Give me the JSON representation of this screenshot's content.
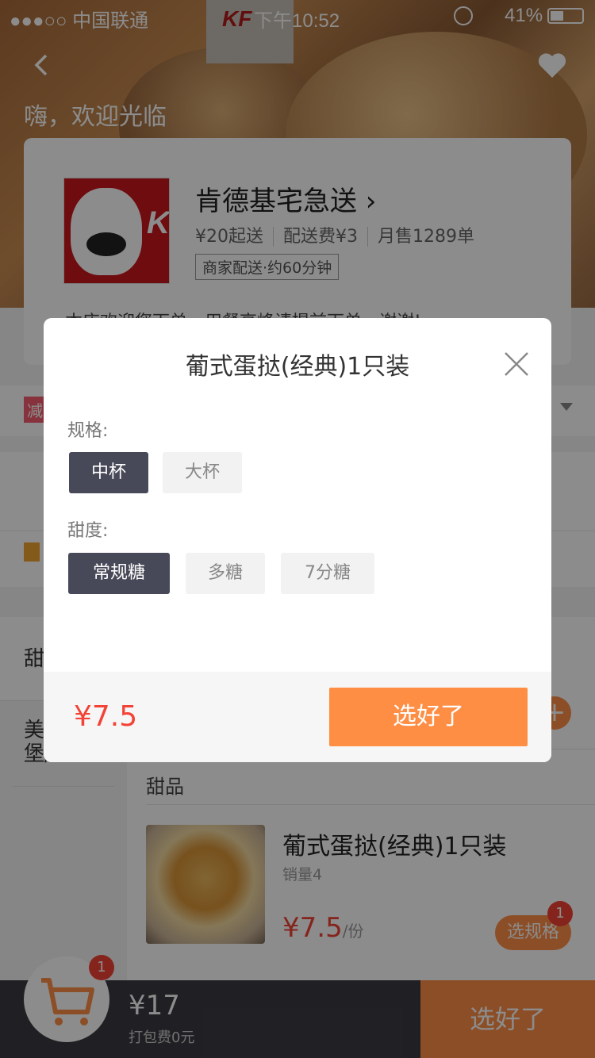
{
  "status_bar": {
    "carrier": "●●●○○ 中国联通",
    "time": "下午10:52",
    "battery": "41%"
  },
  "header": {
    "greeting": "嗨，欢迎光临"
  },
  "shop": {
    "name": "肯德基宅急送",
    "min_order": "¥20起送",
    "delivery_fee": "配送费¥3",
    "monthly_sales": "月售1289单",
    "delivery_tag": "商家配送·约60分钟",
    "notice": "本店欢迎您下单，用餐高峰请提前下单，谢谢!"
  },
  "promo": {
    "badge": "减"
  },
  "side_nav": {
    "items": [
      {
        "label": "甜"
      },
      {
        "label": "美\n堡/包"
      }
    ]
  },
  "menu": {
    "section_title": "甜品",
    "item": {
      "name": "葡式蛋挞(经典)1只装",
      "sales": "销量4",
      "price": "¥7.5",
      "unit": "/份",
      "spec_button": "选规格",
      "spec_count": "1"
    },
    "add_symbol": "+"
  },
  "cart": {
    "count": "1",
    "total": "¥17",
    "packing_fee": "打包费0元",
    "confirm": "选好了"
  },
  "dialog": {
    "title": "葡式蛋挞(经典)1只装",
    "spec_label": "规格:",
    "spec_options": [
      "中杯",
      "大杯"
    ],
    "sweet_label": "甜度:",
    "sweet_options": [
      "常规糖",
      "多糖",
      "7分糖"
    ],
    "price": "¥7.5",
    "confirm": "选好了"
  },
  "colors": {
    "accent": "#ff8e45",
    "price": "#f34336",
    "selected": "#474958"
  }
}
